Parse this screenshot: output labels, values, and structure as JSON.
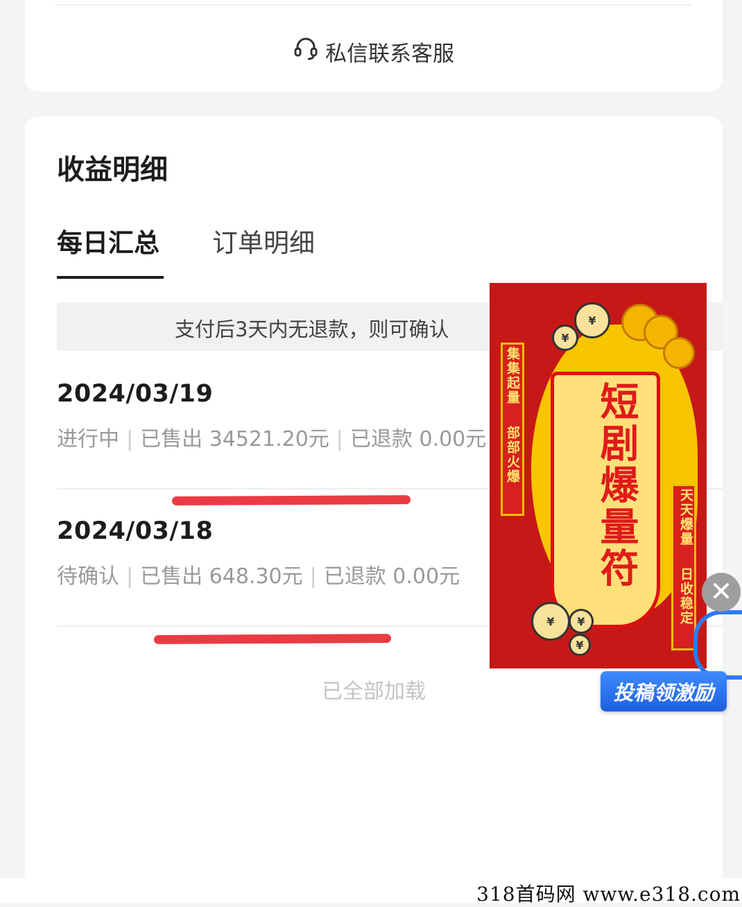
{
  "contact": {
    "icon": "headset-icon",
    "label": "私信联系客服"
  },
  "income": {
    "title": "收益明细",
    "tabs": [
      {
        "label": "每日汇总",
        "active": true
      },
      {
        "label": "订单明细",
        "active": false
      }
    ],
    "notice": "支付后3天内无退款，则可确认",
    "rows": [
      {
        "date": "2024/03/19",
        "status": "进行中",
        "sold": "已售出 34521.20元",
        "refund": "已退款 0.00元"
      },
      {
        "date": "2024/03/18",
        "status": "待确认",
        "sold": "已售出 648.30元",
        "refund": "已退款 0.00元"
      }
    ],
    "footer": "已全部加载"
  },
  "ad": {
    "title": "短剧爆量符",
    "left_banner_1": "集集起量",
    "left_banner_2": "部部火爆",
    "right_banner_1": "天天爆量",
    "right_banner_2": "日收稳定",
    "coin_glyph": "¥",
    "accent_red": "#c71818",
    "accent_yellow": "#f7c600"
  },
  "close_button": {
    "icon": "close-icon"
  },
  "submit_button": {
    "label": "投稿领激励"
  },
  "watermark": {
    "text": "318首码网  www.e318.com"
  },
  "colors": {
    "highlight_marker": "#ea3b44",
    "primary_text": "#1c1c1c",
    "muted_text": "#999999"
  }
}
